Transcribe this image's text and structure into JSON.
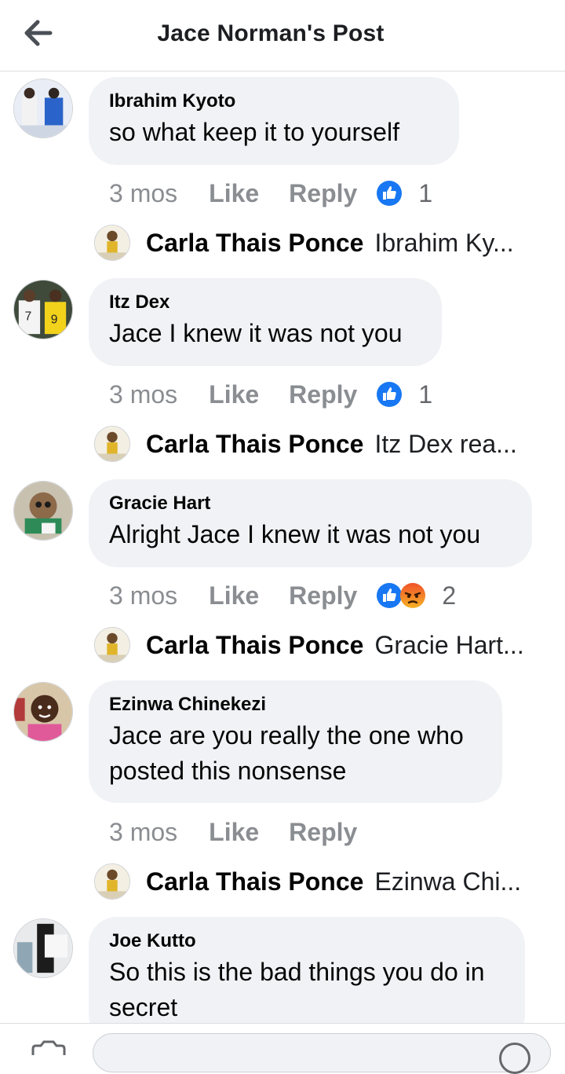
{
  "header": {
    "title": "Jace Norman's Post"
  },
  "colors": {
    "like_blue": "#1877f2",
    "angry_orange": "#f0522b",
    "bubble_bg": "#f0f2f5",
    "meta_gray": "#8a8d91"
  },
  "actions": {
    "like_label": "Like",
    "reply_label": "Reply"
  },
  "comments": [
    {
      "author": "Ibrahim Kyoto",
      "text_lines": [
        "so  what  keep  it to yourself"
      ],
      "time": "3 mos",
      "reactions": [
        "like"
      ],
      "reaction_count": "1",
      "reply": {
        "author": "Carla Thais Ponce",
        "snippet": "Ibrahim Ky..."
      }
    },
    {
      "author": "Itz Dex",
      "text_lines": [
        "Jace I knew it was not you"
      ],
      "time": "3 mos",
      "reactions": [
        "like"
      ],
      "reaction_count": "1",
      "reply": {
        "author": "Carla Thais Ponce",
        "snippet": "Itz Dex rea..."
      }
    },
    {
      "author": "Gracie Hart",
      "text_lines": [
        "Alright Jace I knew it was not you"
      ],
      "time": "3 mos",
      "reactions": [
        "like",
        "angry"
      ],
      "reaction_count": "2",
      "reply": {
        "author": "Carla Thais Ponce",
        "snippet": "Gracie Hart..."
      }
    },
    {
      "author": "Ezinwa Chinekezi",
      "text_lines": [
        "Jace are you really the one who",
        "posted this nonsense"
      ],
      "time": "3 mos",
      "reactions": [],
      "reaction_count": "",
      "reply": {
        "author": "Carla Thais Ponce",
        "snippet": "Ezinwa Chi..."
      }
    },
    {
      "author": "Joe Kutto",
      "text_lines": [
        "So this is the bad things you do in",
        "secret"
      ],
      "time": "",
      "reactions": [],
      "reaction_count": "",
      "reply": null
    }
  ],
  "composer": {
    "placeholder": ""
  }
}
